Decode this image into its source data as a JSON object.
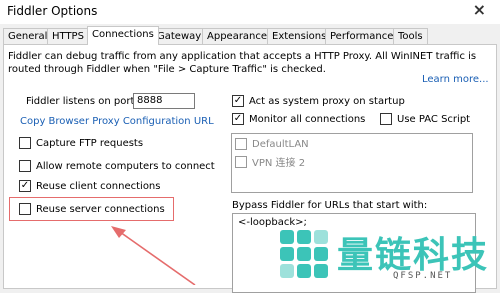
{
  "window": {
    "title": "Fiddler Options",
    "close_glyph": "×"
  },
  "tabs": [
    {
      "label": "General",
      "active": false
    },
    {
      "label": "HTTPS",
      "active": false
    },
    {
      "label": "Connections",
      "active": true
    },
    {
      "label": "Gateway",
      "active": false
    },
    {
      "label": "Appearance",
      "active": false
    },
    {
      "label": "Extensions",
      "active": false
    },
    {
      "label": "Performance",
      "active": false
    },
    {
      "label": "Tools",
      "active": false
    }
  ],
  "connections": {
    "description": "Fiddler can debug traffic from any application that accepts a HTTP Proxy. All WinINET traffic is routed through Fiddler when \"File > Capture Traffic\" is checked.",
    "learn_more": "Learn more...",
    "port_label": "Fiddler listens on port:",
    "port_value": "8888",
    "copy_proxy_link": "Copy Browser Proxy Configuration URL",
    "options": {
      "capture_ftp": {
        "label": "Capture FTP requests",
        "checked": false
      },
      "allow_remote": {
        "label": "Allow remote computers to connect",
        "checked": false
      },
      "reuse_client": {
        "label": "Reuse client connections",
        "checked": true
      },
      "reuse_server": {
        "label": "Reuse server connections",
        "checked": false
      }
    },
    "act_as_system_proxy": {
      "label": "Act as system proxy on startup",
      "checked": true
    },
    "monitor_all": {
      "label": "Monitor all connections",
      "checked": true
    },
    "use_pac": {
      "label": "Use PAC Script",
      "checked": false
    },
    "connection_list": [
      {
        "label": "DefaultLAN",
        "checked": false
      },
      {
        "label": "VPN 连接 2",
        "checked": false
      }
    ],
    "bypass_label": "Bypass Fiddler for URLs that start with:",
    "bypass_value": "<-loopback>;"
  },
  "watermark": {
    "brand": "量链科技",
    "site": "QFSP.NET",
    "color": "#3cc4b8"
  },
  "annotation": {
    "highlight_color": "#e56c6c"
  }
}
